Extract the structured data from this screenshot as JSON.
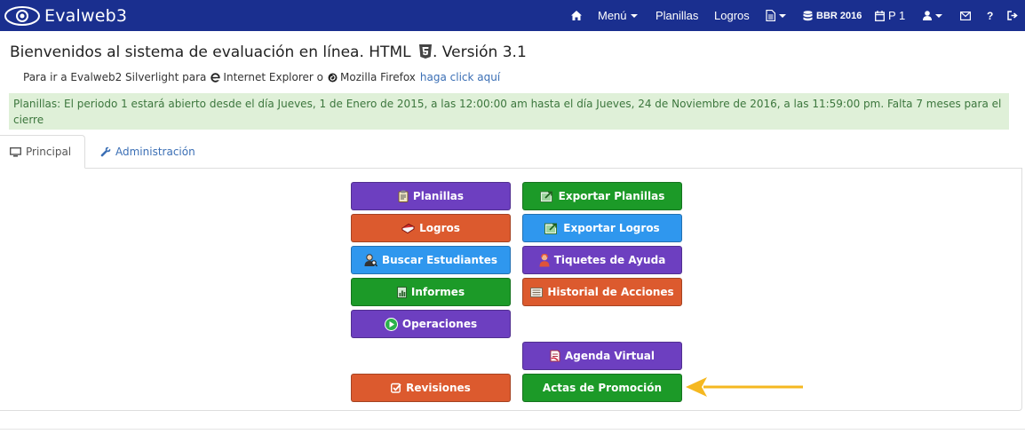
{
  "navbar": {
    "brand": "Evalweb3",
    "items": {
      "home_icon": "home-icon",
      "menu": "Menú",
      "planillas": "Planillas",
      "logros": "Logros",
      "database": "BBR 2016",
      "period": "P 1"
    },
    "colors": {
      "background": "#1a2f8f"
    }
  },
  "header": {
    "welcome": "Bienvenidos al sistema de evaluación en línea. HTML",
    "version": ". Versión 3.1",
    "subline_prefix": "Para ir a Evalweb2 Silverlight para",
    "ie_text": "Internet Explorer o",
    "firefox_text": "Mozilla Firefox",
    "link_text": "haga click aquí"
  },
  "alert": {
    "text": "Planillas: El periodo 1 estará abierto desde el día Jueves, 1 de Enero de 2015, a las 12:00:00 am hasta el día Jueves, 24 de Noviembre de 2016, a las 11:59:00 pm. Falta 7 meses para el cierre"
  },
  "tabs": {
    "principal": "Principal",
    "administracion": "Administración"
  },
  "buttons": {
    "planillas": "Planillas",
    "exportar_planillas": "Exportar Planillas",
    "logros": "Logros",
    "exportar_logros": "Exportar Logros",
    "buscar_estudiantes": "Buscar Estudiantes",
    "tiquetes_ayuda": "Tiquetes de Ayuda",
    "informes": "Informes",
    "historial_acciones": "Historial de Acciones",
    "operaciones": "Operaciones",
    "agenda_virtual": "Agenda Virtual",
    "revisiones": "Revisiones",
    "actas_promocion": "Actas de Promoción"
  },
  "colors": {
    "purple": "#6d3fc0",
    "orange": "#dc5a2e",
    "blue": "#2f97ee",
    "green": "#1c9a28",
    "alert_bg": "#dff0d8",
    "arrow": "#f5b820"
  }
}
